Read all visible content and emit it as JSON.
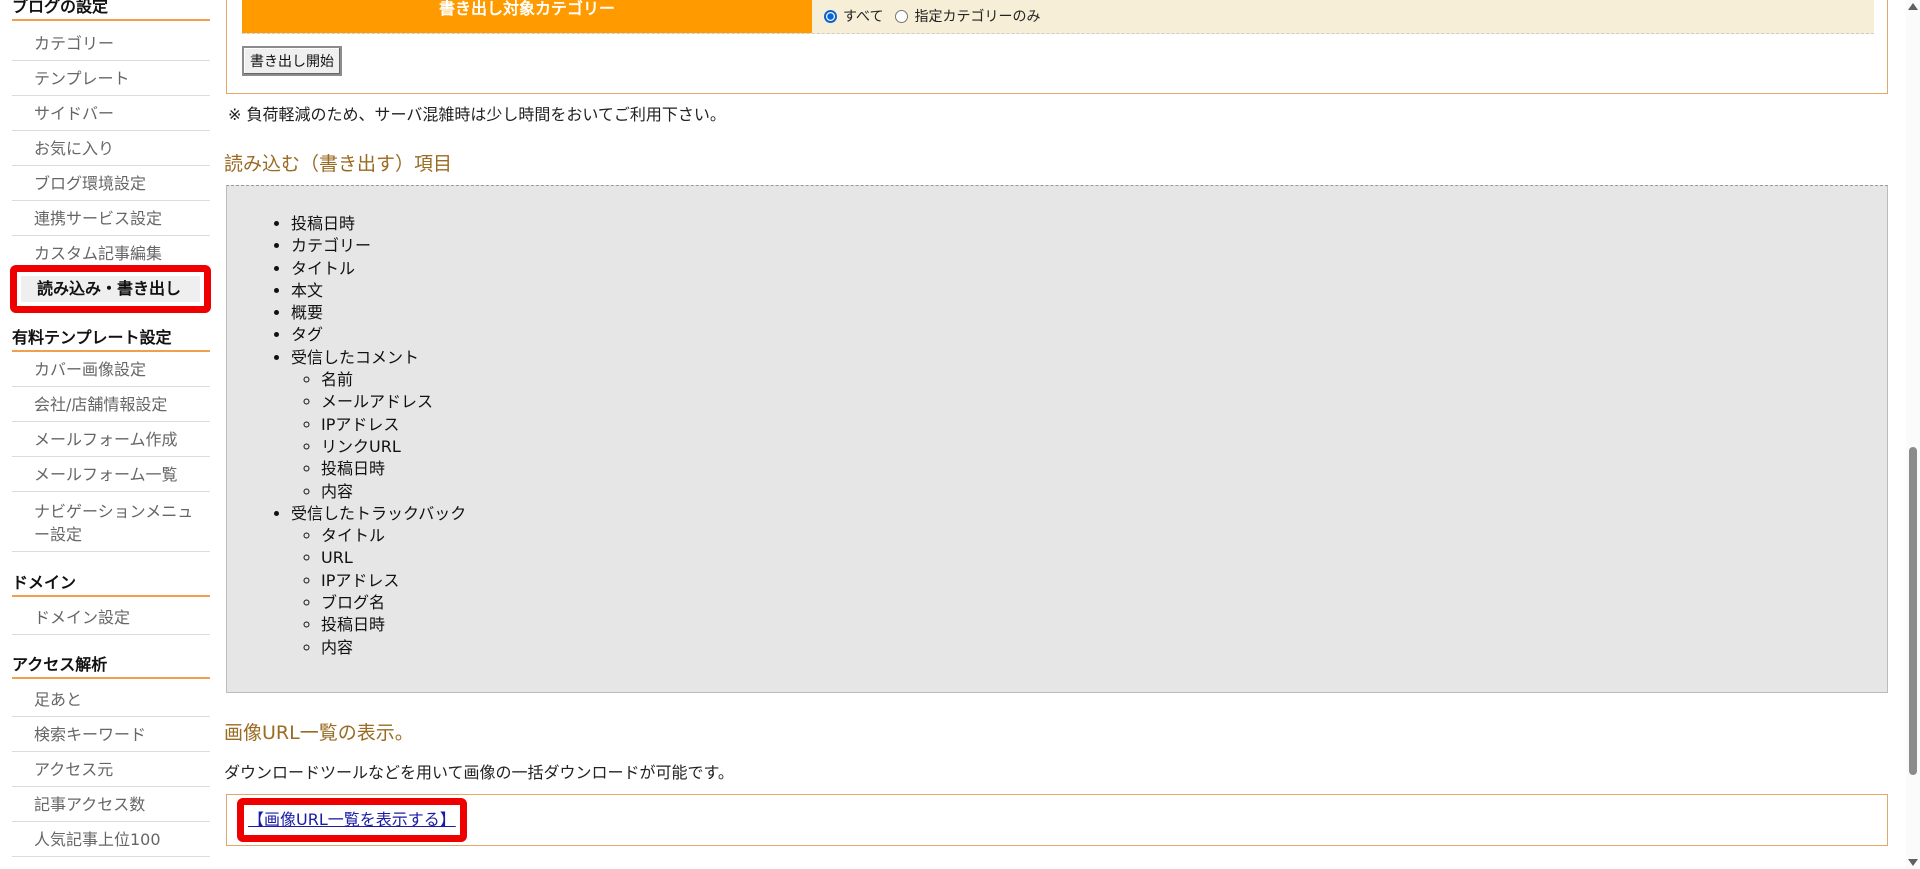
{
  "sidebar": {
    "blog_settings": {
      "heading": "ブログの設定",
      "items": [
        "カテゴリー",
        "テンプレート",
        "サイドバー",
        "お気に入り",
        "ブログ環境設定",
        "連携サービス設定",
        "カスタム記事編集"
      ],
      "active": "読み込み・書き出し"
    },
    "paid_template": {
      "heading": "有料テンプレート設定",
      "items": [
        "カバー画像設定",
        "会社/店舗情報設定",
        "メールフォーム作成",
        "メールフォーム一覧"
      ],
      "nav_menu": "ナビゲーションメニュー設定"
    },
    "domain": {
      "heading": "ドメイン",
      "items": [
        "ドメイン設定"
      ]
    },
    "access": {
      "heading": "アクセス解析",
      "items": [
        "足あと",
        "検索キーワード",
        "アクセス元",
        "記事アクセス数",
        "人気記事上位100"
      ]
    }
  },
  "export": {
    "category_label": "書き出し対象カテゴリー",
    "option_all": "すべて",
    "option_specific": "指定カテゴリーのみ",
    "selected": "すべて",
    "start_button": "書き出し開始"
  },
  "note": "※ 負荷軽減のため、サーバ混雑時は少し時間をおいてご利用下さい。",
  "items_section": {
    "title": "読み込む（書き出す）項目",
    "items": [
      "投稿日時",
      "カテゴリー",
      "タイトル",
      "本文",
      "概要",
      "タグ"
    ],
    "comments": {
      "label": "受信したコメント",
      "sub": [
        "名前",
        "メールアドレス",
        "IPアドレス",
        "リンクURL",
        "投稿日時",
        "内容"
      ]
    },
    "trackbacks": {
      "label": "受信したトラックバック",
      "sub": [
        "タイトル",
        "URL",
        "IPアドレス",
        "ブログ名",
        "投稿日時",
        "内容"
      ]
    }
  },
  "image_url": {
    "title": "画像URL一覧の表示。",
    "description": "ダウンロードツールなどを用いて画像の一括ダウンロードが可能です。",
    "link": "【画像URL一覧を表示する】"
  },
  "colors": {
    "accent_orange": "#ff9b00",
    "heading_brown": "#9a6b23",
    "highlight_red": "#ee0000",
    "link_blue": "#1a1aa6"
  }
}
